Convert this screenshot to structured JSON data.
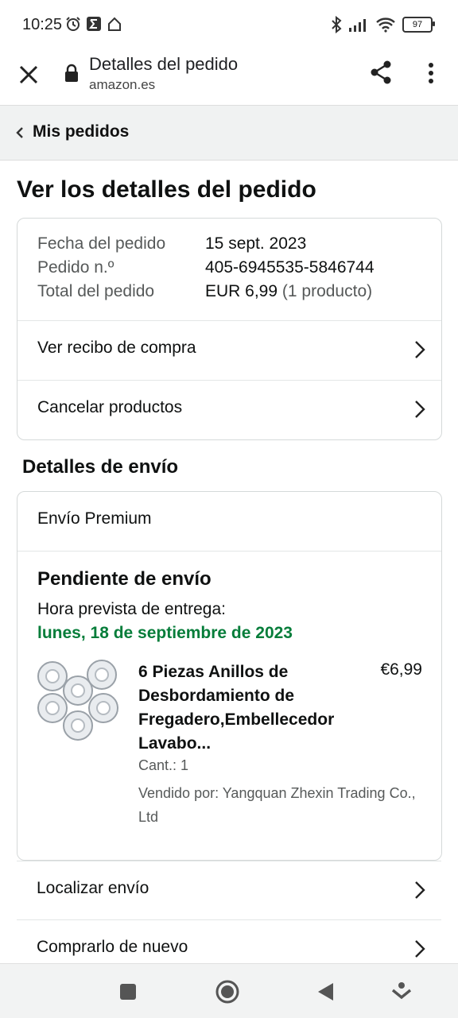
{
  "status": {
    "time": "10:25",
    "battery": "97",
    "left_icons": [
      "alarm-icon",
      "sigma-app-icon",
      "home-icon"
    ],
    "right_icons": [
      "bluetooth-icon",
      "signal-icon",
      "wifi-icon",
      "battery-icon"
    ]
  },
  "browser": {
    "title": "Detalles del pedido",
    "domain": "amazon.es"
  },
  "breadcrumb": {
    "label": "Mis pedidos"
  },
  "page": {
    "title": "Ver los detalles del pedido"
  },
  "summary": {
    "date_label": "Fecha del pedido",
    "date_value": "15 sept. 2023",
    "order_label": "Pedido n.º",
    "order_value": "405-6945535-5846744",
    "total_label": "Total del pedido",
    "total_value": "EUR 6,99",
    "total_note": "(1 producto)",
    "receipt_link": "Ver recibo de compra",
    "cancel_link": "Cancelar productos"
  },
  "shipping": {
    "section_title": "Detalles de envío",
    "type": "Envío Premium",
    "status": "Pendiente de envío",
    "eta_label": "Hora prevista de entrega:",
    "eta_date": "lunes, 18 de septiembre de 2023",
    "product": {
      "name": "6 Piezas Anillos de Desbordamiento de Fregadero,Embellecedor Lavabo...",
      "price": "€6,99",
      "qty": "Cant.: 1",
      "seller": "Vendido por: Yangquan Zhexin Trading Co., Ltd"
    }
  },
  "actions": {
    "track": "Localizar envío",
    "buy_again": "Comprarlo de nuevo"
  },
  "colors": {
    "eta_green": "#067d3a",
    "crumb_bg": "#f0f2f2",
    "border": "#d5d9d9"
  }
}
